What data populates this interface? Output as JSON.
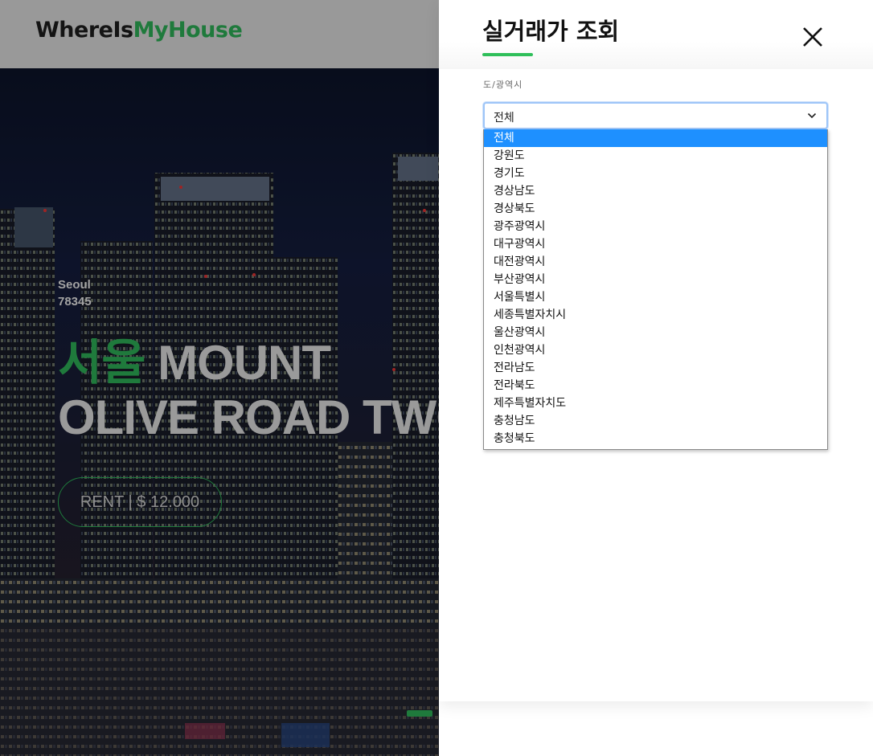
{
  "header": {
    "logo_part1": "WhereIs",
    "logo_part2": "MyHouse"
  },
  "hero": {
    "location_city": "Seoul",
    "location_code": "78345",
    "headline_accent": "서울",
    "headline_line1": "MOUNT",
    "headline_line2": "OLIVE ROAD TWO",
    "rent_label": "RENT | $ 12.000"
  },
  "panel": {
    "title": "실거래가 조회",
    "close_icon": "close-icon",
    "region_label": "도/광역시",
    "select": {
      "value": "전체",
      "icon": "chevron-down-icon",
      "options": [
        "전체",
        "강원도",
        "경기도",
        "경상남도",
        "경상북도",
        "광주광역시",
        "대구광역시",
        "대전광역시",
        "부산광역시",
        "서울특별시",
        "세종특별자치시",
        "울산광역시",
        "인천광역시",
        "전라남도",
        "전라북도",
        "제주특별자치도",
        "충청남도",
        "충청북도"
      ],
      "highlighted_index": 0
    }
  },
  "colors": {
    "brand_green": "#1f7a3c",
    "underline_green": "#2fbf5a",
    "option_highlight": "#1e90ff",
    "header_gray": "#999999"
  }
}
